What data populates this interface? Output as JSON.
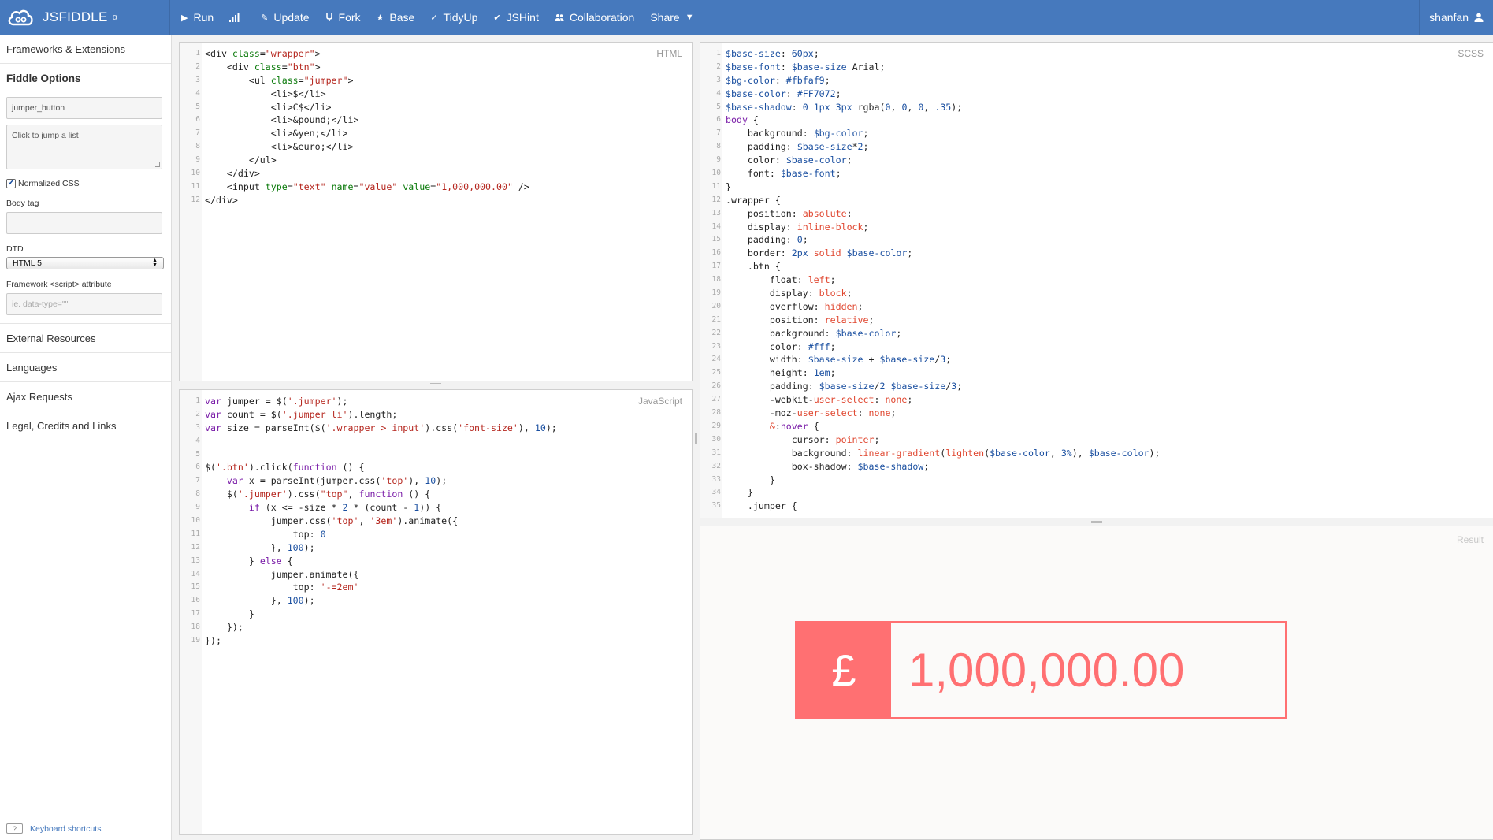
{
  "brand": {
    "name": "JSFIDDLE",
    "badge": "α",
    "accent": "#4679bd"
  },
  "nav": {
    "run": "Run",
    "update": "Update",
    "fork": "Fork",
    "base": "Base",
    "tidyup": "TidyUp",
    "jshint": "JSHint",
    "collaboration": "Collaboration",
    "share": "Share",
    "user": "shanfan"
  },
  "sidebar": {
    "frameworks": "Frameworks & Extensions",
    "options_title": "Fiddle Options",
    "fiddle_name": "jumper_button",
    "fiddle_desc": "Click to jump a list",
    "normalized_css": "Normalized CSS",
    "normalized_checked": true,
    "body_tag_label": "Body tag",
    "body_tag_value": "",
    "dtd_label": "DTD",
    "dtd_value": "HTML 5",
    "framework_attr_label": "Framework <script> attribute",
    "framework_attr_placeholder": "ie. data-type=\"\"",
    "external_resources": "External Resources",
    "languages": "Languages",
    "ajax_requests": "Ajax Requests",
    "legal": "Legal, Credits and Links",
    "keyboard_shortcuts": "Keyboard shortcuts",
    "keyboard_icon": "?"
  },
  "panels": {
    "html_label": "HTML",
    "js_label": "JavaScript",
    "scss_label": "SCSS",
    "result_label": "Result"
  },
  "result": {
    "symbol": "£",
    "value": "1,000,000.00",
    "color": "#FF7072",
    "bg": "#fbfaf9"
  }
}
